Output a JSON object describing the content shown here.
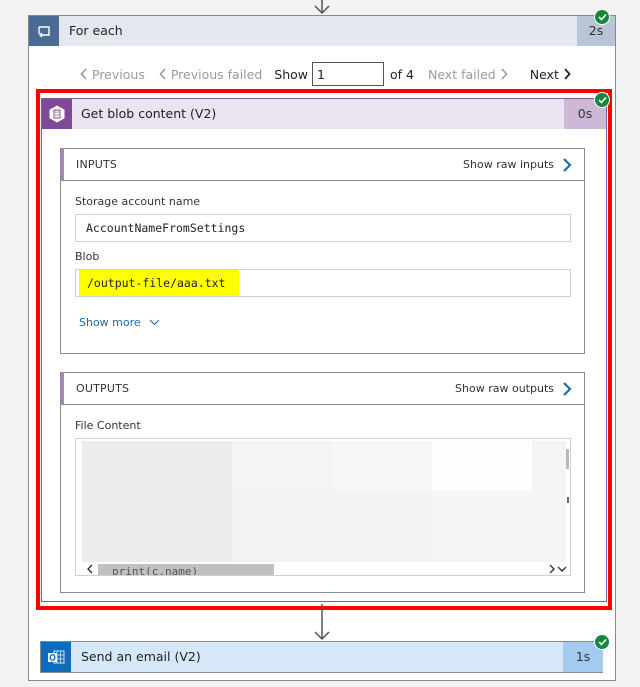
{
  "foreach": {
    "title": "For each",
    "duration": "2s",
    "icon": "loop-icon",
    "status": "succeeded"
  },
  "pager": {
    "previous": "Previous",
    "previous_failed": "Previous failed",
    "show_label": "Show",
    "current": "1",
    "of_total": "of 4",
    "next_failed": "Next failed",
    "next": "Next"
  },
  "action": {
    "title": "Get blob content (V2)",
    "duration": "0s",
    "icon": "azure-blob-storage-icon",
    "status": "succeeded",
    "inputs": {
      "title": "INPUTS",
      "raw_link": "Show raw inputs",
      "fields": [
        {
          "label": "Storage account name",
          "value": "AccountNameFromSettings"
        },
        {
          "label": "Blob",
          "value": "/output-file/aaa.txt"
        }
      ],
      "show_more": "Show more"
    },
    "outputs": {
      "title": "OUTPUTS",
      "raw_link": "Show raw outputs",
      "file_content_label": "File Content",
      "visible_code_fragment": "print(c.name)"
    }
  },
  "email": {
    "title": "Send an email (V2)",
    "duration": "1s",
    "icon": "outlook-icon",
    "status": "succeeded"
  },
  "colors": {
    "highlight_outline": "#ff0000",
    "success": "#13893e",
    "blob_accent": "#804998",
    "outlook_accent": "#0f6cbd",
    "loop_accent": "#4a6b94",
    "link": "#1f6aa8"
  }
}
